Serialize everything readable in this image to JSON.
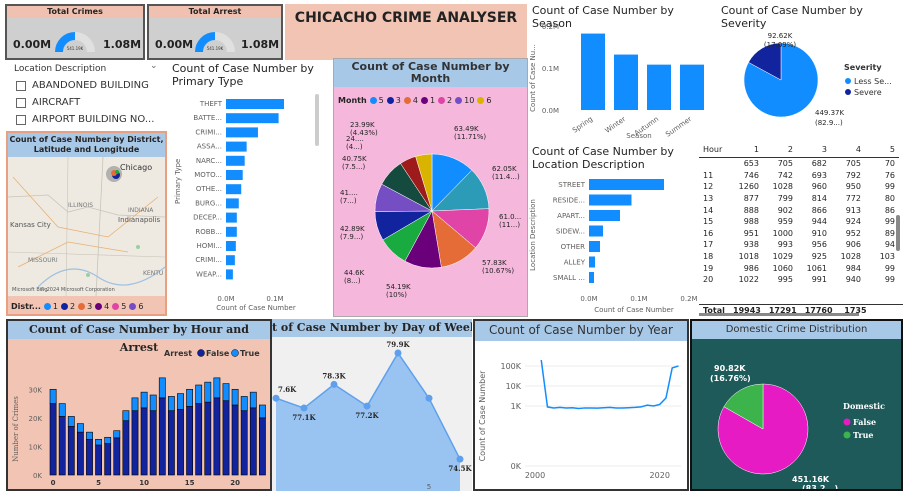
{
  "kpis": [
    {
      "title": "Total Crimes",
      "min": "0.00M",
      "center": "541.19K",
      "max": "1.08M",
      "fill": 0.5
    },
    {
      "title": "Total Arrest",
      "min": "0.00M",
      "center": "541.19K",
      "max": "1.08M",
      "fill": 0.5
    }
  ],
  "header": {
    "title": "CHICACHO CRIME ANALYSER"
  },
  "slicer": {
    "label": "Location Description",
    "items": [
      "ABANDONED BUILDING",
      "AIRCRAFT",
      "AIRPORT BUILDING NO..."
    ]
  },
  "map": {
    "title": "Count of Case Number by District, Latitude and Longitude",
    "labels": {
      "chicago": "Chicago",
      "illinois": "ILLINOIS",
      "indiana": "INDIANA",
      "indianapolis": "Indianapolis",
      "kansas": "Kansas City",
      "missouri": "MISSOURI",
      "kentucky": "KENTU"
    },
    "legend_title": "Distr...",
    "legend_items": [
      "1",
      "2",
      "3",
      "4",
      "5",
      "6"
    ],
    "legend_colors": [
      "#118dff",
      "#12239e",
      "#e66c37",
      "#6b007b",
      "#e044a7",
      "#744ec2"
    ],
    "credit": "Microsoft Bing",
    "copyright": "© 2024 Microsoft Corporation"
  },
  "primary_type": {
    "title": "Count of Case Number by Primary Type",
    "y_title": "Primary Type",
    "x_title": "Count of Case Number",
    "x_ticks": [
      "0.0M",
      "0.1M"
    ]
  },
  "month": {
    "title": "Count of Case Number by Month",
    "legend_title": "Month",
    "legend_items": [
      {
        "label": "5",
        "color": "#118dff"
      },
      {
        "label": "3",
        "color": "#12239e"
      },
      {
        "label": "4",
        "color": "#e66c37"
      },
      {
        "label": "1",
        "color": "#6b007b"
      },
      {
        "label": "2",
        "color": "#e044a7"
      },
      {
        "label": "10",
        "color": "#744ec2"
      },
      {
        "label": "6",
        "color": "#d9b300"
      }
    ]
  },
  "season": {
    "title": "Count of Case Number by Season",
    "y_title": "Count of Case Nu...",
    "x_title": "Season",
    "y_ticks": [
      "0.0M",
      "0.1M",
      "0.2M"
    ]
  },
  "severity": {
    "title": "Count of Case Number by Severity",
    "legend_title": "Severity",
    "legend_items": [
      {
        "label": "Less Se...",
        "color": "#118dff"
      },
      {
        "label": "Severe",
        "color": "#12239e"
      }
    ],
    "label_top": "92.62K",
    "label_top2": "(17.09%)",
    "label_bottom": "449.37K",
    "label_bottom2": "(82.9...)"
  },
  "location": {
    "title": "Count of Case Number by Location Description",
    "y_title": "Location Description",
    "x_title": "Count of Case Number",
    "x_ticks": [
      "0.0M",
      "0.1M",
      "0.2M"
    ]
  },
  "matrix": {
    "header": [
      "Hour",
      "1",
      "2",
      "3",
      "4",
      "5"
    ],
    "rows": [
      [
        "",
        "653",
        "705",
        "682",
        "705",
        "70"
      ],
      [
        "11",
        "746",
        "742",
        "693",
        "792",
        "76"
      ],
      [
        "12",
        "1260",
        "1028",
        "960",
        "950",
        "99"
      ],
      [
        "13",
        "877",
        "799",
        "814",
        "772",
        "80"
      ],
      [
        "14",
        "888",
        "902",
        "866",
        "913",
        "86"
      ],
      [
        "15",
        "988",
        "959",
        "944",
        "924",
        "99"
      ],
      [
        "16",
        "951",
        "1000",
        "910",
        "952",
        "89"
      ],
      [
        "17",
        "938",
        "993",
        "956",
        "906",
        "94"
      ],
      [
        "18",
        "1018",
        "1029",
        "925",
        "1028",
        "103"
      ],
      [
        "19",
        "986",
        "1060",
        "1061",
        "984",
        "99"
      ],
      [
        "20",
        "1022",
        "995",
        "991",
        "940",
        "99"
      ]
    ],
    "total": [
      "Total",
      "19943",
      "17291",
      "17760",
      "1735"
    ]
  },
  "hour_arrest": {
    "title": "Count of Case Number by Hour and Arrest",
    "legend_title": "Arrest",
    "legend_items": [
      {
        "label": "False",
        "color": "#12239e"
      },
      {
        "label": "True",
        "color": "#118dff"
      }
    ],
    "y_title": "Number of Crimes",
    "y_ticks": [
      "0K",
      "10K",
      "20K",
      "30K"
    ],
    "x_ticks": [
      "0",
      "5",
      "10",
      "15",
      "20"
    ]
  },
  "day_week": {
    "title": "t of Case Number by Day of Week",
    "x_ticks": [
      "5"
    ]
  },
  "year": {
    "title": "Count of Case Number by Year",
    "y_title": "Count of Case Number",
    "y_ticks": [
      "0K",
      "1K",
      "10K",
      "100K"
    ],
    "x_ticks": [
      "2000",
      "2020"
    ]
  },
  "domestic": {
    "title": "Domestic Crime Distribution",
    "legend_title": "Domestic",
    "legend_items": [
      {
        "label": "False",
        "color": "#e61bc3"
      },
      {
        "label": "True",
        "color": "#3cb44b"
      }
    ],
    "label_true": "90.82K",
    "label_true2": "(16.76%)",
    "label_false": "451.16K",
    "label_false2": "(83.2...)"
  },
  "chart_data": [
    {
      "type": "bar",
      "title": "Count of Case Number by Primary Type",
      "categories": [
        "THEFT",
        "BATTE...",
        "CRIMI...",
        "ASSA...",
        "NARC...",
        "MOTO...",
        "OTHE...",
        "BURG...",
        "DECEP...",
        "ROBB...",
        "HOMI...",
        "CRIMI...",
        "WEAP..."
      ],
      "values": [
        118000,
        107000,
        65000,
        42000,
        38000,
        34000,
        31000,
        26000,
        22000,
        22000,
        20000,
        18000,
        14000
      ],
      "xlabel": "Count of Case Number",
      "ylabel": "Primary Type"
    },
    {
      "type": "pie",
      "title": "Count of Case Number by Month",
      "labels": [
        "63.49K (11.71%)",
        "62.05K (11.4...)",
        "61.0... (11...)",
        "57.83K (10.67%)",
        "54.19K (10%)",
        "44.6K (8...)",
        "42.89K (7.9...)",
        "41.... (7...)",
        "40.75K (7.5...)",
        "24.... (4...)",
        "23.99K (4.43%)"
      ],
      "values": [
        63490,
        62050,
        61000,
        57830,
        54190,
        44600,
        42890,
        41000,
        40750,
        24000,
        23990
      ],
      "colors": [
        "#118dff",
        "#2b9bb8",
        "#e044a7",
        "#e66c37",
        "#6b007b",
        "#1aab40",
        "#12239e",
        "#744ec2",
        "#154a3e",
        "#9e1b1b",
        "#d9b300"
      ]
    },
    {
      "type": "bar",
      "title": "Count of Case Number by Season",
      "categories": [
        "Spring",
        "Winter",
        "Autumn",
        "Summer"
      ],
      "values": [
        182000,
        132000,
        108000,
        108000
      ],
      "ylabel": "Count of Case Nu...",
      "xlabel": "Season",
      "ylim": [
        0,
        200000
      ]
    },
    {
      "type": "pie",
      "title": "Count of Case Number by Severity",
      "labels": [
        "Less Se...",
        "Severe"
      ],
      "values": [
        449370,
        92620
      ]
    },
    {
      "type": "bar",
      "title": "Count of Case Number by Location Description",
      "categories": [
        "STREET",
        "RESIDE...",
        "APART...",
        "SIDEW...",
        "OTHER",
        "ALLEY",
        "SMALL ..."
      ],
      "values": [
        150000,
        85000,
        62000,
        28000,
        22000,
        12000,
        10000
      ],
      "xlim": [
        0,
        200000
      ]
    },
    {
      "type": "bar",
      "title": "Count of Case Number by Hour and Arrest",
      "categories": [
        "0",
        "1",
        "2",
        "3",
        "4",
        "5",
        "6",
        "7",
        "8",
        "9",
        "10",
        "11",
        "12",
        "13",
        "14",
        "15",
        "16",
        "17",
        "18",
        "19",
        "20",
        "21",
        "22",
        "23"
      ],
      "series": [
        {
          "name": "False",
          "values": [
            25000,
            20500,
            17000,
            15000,
            12500,
            10500,
            11000,
            13000,
            19000,
            22500,
            23500,
            22500,
            27000,
            22500,
            23000,
            24000,
            25000,
            25500,
            27000,
            26000,
            24500,
            22500,
            23500,
            20000
          ]
        },
        {
          "name": "True",
          "values": [
            5000,
            4500,
            3500,
            3000,
            2500,
            2000,
            2200,
            2500,
            3500,
            4500,
            5500,
            5500,
            7000,
            5000,
            5500,
            6000,
            6500,
            7000,
            7000,
            6000,
            5500,
            5000,
            5500,
            4500
          ]
        }
      ],
      "ylim": [
        0,
        35000
      ]
    },
    {
      "type": "area",
      "title": "Count of Case Number by Day of Week",
      "x": [
        1,
        2,
        3,
        4,
        5,
        6,
        7
      ],
      "values": [
        77600,
        77100,
        78300,
        77200,
        79900,
        77600,
        74500
      ],
      "labels": [
        "7.6K",
        "77.1K",
        "78.3K",
        "77.2K",
        "79.9K",
        "",
        "74.5K"
      ]
    },
    {
      "type": "line",
      "title": "Count of Case Number by Year",
      "x": [
        2001,
        2002,
        2003,
        2004,
        2005,
        2006,
        2007,
        2008,
        2009,
        2010,
        2011,
        2012,
        2013,
        2014,
        2015,
        2016,
        2017,
        2018,
        2019,
        2020,
        2021,
        2022,
        2023
      ],
      "values": [
        200000,
        900,
        800,
        850,
        800,
        820,
        750,
        800,
        800,
        780,
        820,
        850,
        800,
        800,
        820,
        850,
        900,
        1100,
        1000,
        1200,
        2500,
        80000,
        100000
      ],
      "scale": "log"
    },
    {
      "type": "pie",
      "title": "Domestic Crime Distribution",
      "labels": [
        "False",
        "True"
      ],
      "values": [
        451160,
        90820
      ]
    }
  ]
}
